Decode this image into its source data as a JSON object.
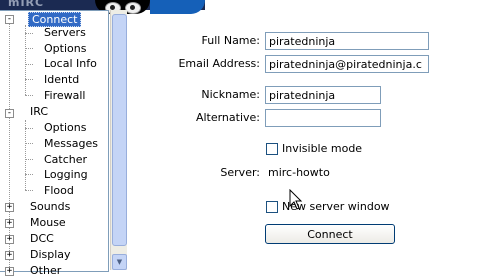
{
  "brand": {
    "watermark_text": "mIRC"
  },
  "tree": {
    "items": [
      {
        "label": "Connect",
        "level": 0,
        "expander": "-",
        "selected": true
      },
      {
        "label": "Servers",
        "level": 1
      },
      {
        "label": "Options",
        "level": 1
      },
      {
        "label": "Local Info",
        "level": 1
      },
      {
        "label": "Identd",
        "level": 1
      },
      {
        "label": "Firewall",
        "level": 1
      },
      {
        "label": "IRC",
        "level": 0,
        "expander": "-"
      },
      {
        "label": "Options",
        "level": 1
      },
      {
        "label": "Messages",
        "level": 1
      },
      {
        "label": "Catcher",
        "level": 1
      },
      {
        "label": "Logging",
        "level": 1
      },
      {
        "label": "Flood",
        "level": 1
      },
      {
        "label": "Sounds",
        "level": 0,
        "expander": "+"
      },
      {
        "label": "Mouse",
        "level": 0,
        "expander": "+"
      },
      {
        "label": "DCC",
        "level": 0,
        "expander": "+"
      },
      {
        "label": "Display",
        "level": 0,
        "expander": "+"
      },
      {
        "label": "Other",
        "level": 0,
        "expander": "+"
      }
    ]
  },
  "form": {
    "full_name": {
      "label": "Full Name:",
      "value": "piratedninja"
    },
    "email": {
      "label": "Email Address:",
      "value": "piratedninja@piratedninja.c"
    },
    "nickname": {
      "label": "Nickname:",
      "value": "piratedninja"
    },
    "alternative": {
      "label": "Alternative:",
      "value": ""
    },
    "invisible_mode": {
      "label": "Invisible mode",
      "checked": false
    },
    "server": {
      "label": "Server:",
      "value": "mirc-howto"
    },
    "new_server_window": {
      "label": "New server window",
      "checked": false
    },
    "connect_button": "Connect"
  },
  "icons": {
    "cursor": "arrow-cursor-icon"
  },
  "colors": {
    "selection": "#316ac5",
    "field_border": "#7f9db9",
    "button_border": "#003c74"
  }
}
